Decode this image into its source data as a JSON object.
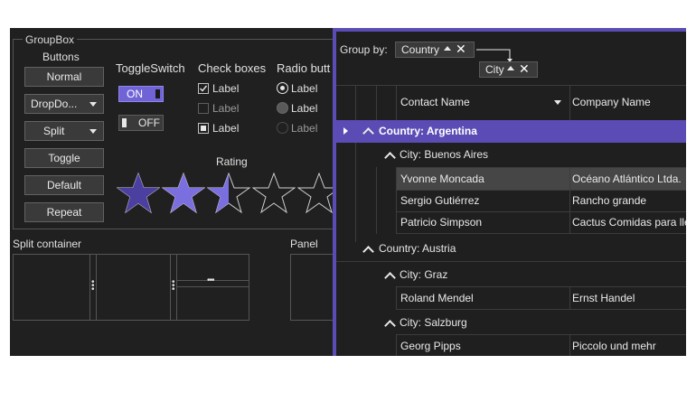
{
  "groupbox": {
    "title": "GroupBox"
  },
  "buttons": {
    "header": "Buttons",
    "normal": "Normal",
    "dropdown": "DropDo...",
    "split": "Split",
    "toggle": "Toggle",
    "default": "Default",
    "repeat": "Repeat"
  },
  "toggleswitch": {
    "header": "ToggleSwitch",
    "on_label": "ON",
    "off_label": "OFF"
  },
  "checkboxes": {
    "header": "Check boxes",
    "items": [
      "Label",
      "Label",
      "Label"
    ]
  },
  "radios": {
    "header": "Radio butt",
    "items": [
      "Label",
      "Label",
      "Label"
    ]
  },
  "rating": {
    "header": "Rating",
    "value": 2.5,
    "max": 5
  },
  "split_container": {
    "header": "Split container"
  },
  "panel": {
    "header": "Panel"
  },
  "grid": {
    "group_by_label": "Group by:",
    "chips": [
      "Country",
      "City"
    ],
    "columns": [
      "Contact Name",
      "Company Name"
    ],
    "groups": [
      {
        "label": "Country: Argentina"
      },
      {
        "label": "City: Buenos Aires"
      },
      {
        "label": "Country: Austria"
      },
      {
        "label": "City: Graz"
      },
      {
        "label": "City: Salzburg"
      }
    ],
    "rows": [
      {
        "contact": "Yvonne Moncada",
        "company": "Océano Atlántico Ltda."
      },
      {
        "contact": "Sergio Gutiérrez",
        "company": "Rancho grande"
      },
      {
        "contact": "Patricio Simpson",
        "company": "Cactus Comidas para llevar"
      },
      {
        "contact": "Roland Mendel",
        "company": "Ernst Handel"
      },
      {
        "contact": "Georg Pipps",
        "company": "Piccolo und mehr"
      }
    ]
  },
  "colors": {
    "accent": "#5b4cb5",
    "star_fill": "#7b6fe0",
    "star_dark": "#4b3f9f"
  }
}
